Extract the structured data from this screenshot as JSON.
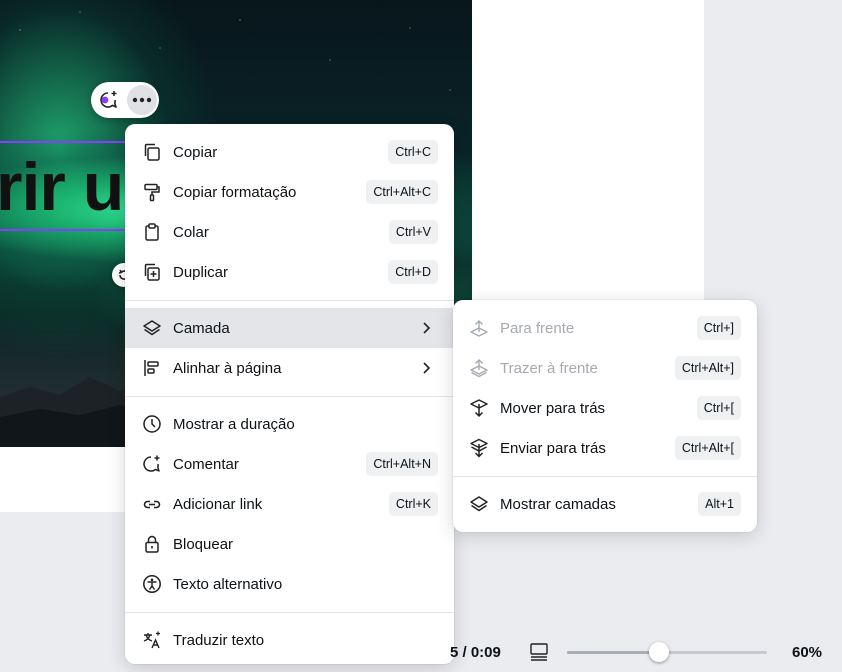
{
  "canvas": {
    "headline": "rir u"
  },
  "floating_toolbar": {
    "icons": [
      "ai-comment-icon",
      "more-options-icon"
    ]
  },
  "context_menu": {
    "items": [
      {
        "label": "Copiar",
        "shortcut": "Ctrl+C",
        "icon": "copy-icon"
      },
      {
        "label": "Copiar formatação",
        "shortcut": "Ctrl+Alt+C",
        "icon": "paint-roller-icon"
      },
      {
        "label": "Colar",
        "shortcut": "Ctrl+V",
        "icon": "clipboard-icon"
      },
      {
        "label": "Duplicar",
        "shortcut": "Ctrl+D",
        "icon": "duplicate-icon"
      },
      {
        "label": "Camada",
        "icon": "layers-icon",
        "submenu": true,
        "highlighted": true
      },
      {
        "label": "Alinhar à página",
        "icon": "align-icon",
        "submenu": true
      },
      {
        "label": "Mostrar a duração",
        "icon": "clock-icon"
      },
      {
        "label": "Comentar",
        "shortcut": "Ctrl+Alt+N",
        "icon": "comment-icon"
      },
      {
        "label": "Adicionar link",
        "shortcut": "Ctrl+K",
        "icon": "link-icon"
      },
      {
        "label": "Bloquear",
        "icon": "lock-icon"
      },
      {
        "label": "Texto alternativo",
        "icon": "accessibility-icon"
      },
      {
        "label": "Traduzir texto",
        "icon": "translate-icon"
      }
    ]
  },
  "layer_submenu": {
    "items": [
      {
        "label": "Para frente",
        "shortcut": "Ctrl+]",
        "icon": "bring-forward-icon",
        "disabled": true
      },
      {
        "label": "Trazer à frente",
        "shortcut": "Ctrl+Alt+]",
        "icon": "bring-to-front-icon",
        "disabled": true
      },
      {
        "label": "Mover para trás",
        "shortcut": "Ctrl+[",
        "icon": "send-backward-icon"
      },
      {
        "label": "Enviar para trás",
        "shortcut": "Ctrl+Alt+[",
        "icon": "send-to-back-icon"
      },
      {
        "label": "Mostrar camadas",
        "shortcut": "Alt+1",
        "icon": "layers-icon"
      }
    ]
  },
  "bottom_bar": {
    "time": "5 / 0:09",
    "zoom_level": 0.46,
    "zoom_label": "60%",
    "icons": [
      "pages-grid-icon"
    ]
  },
  "colors": {
    "selection": "#8b3dff",
    "menu_highlight": "#e4e5e9",
    "disabled_text": "#a6aab0"
  }
}
